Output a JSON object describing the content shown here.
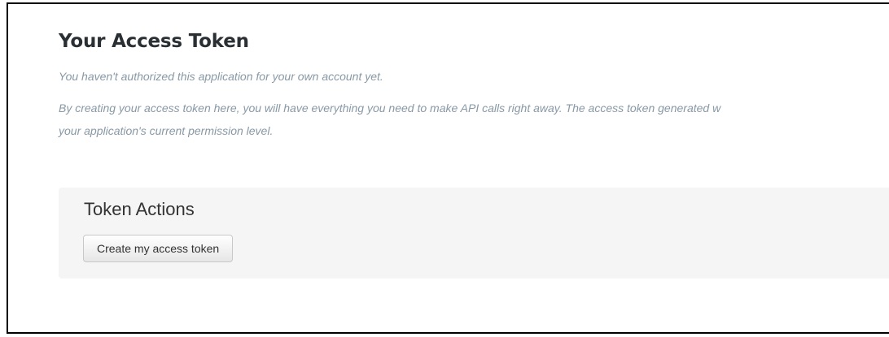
{
  "access_token": {
    "title": "Your Access Token",
    "not_authorized_note": "You haven't authorized this application for your own account yet.",
    "description_line1": "By creating your access token here, you will have everything you need to make API calls right away. The access token generated w",
    "description_line2": "your application's current permission level."
  },
  "token_actions": {
    "title": "Token Actions",
    "create_button_label": "Create my access token"
  }
}
